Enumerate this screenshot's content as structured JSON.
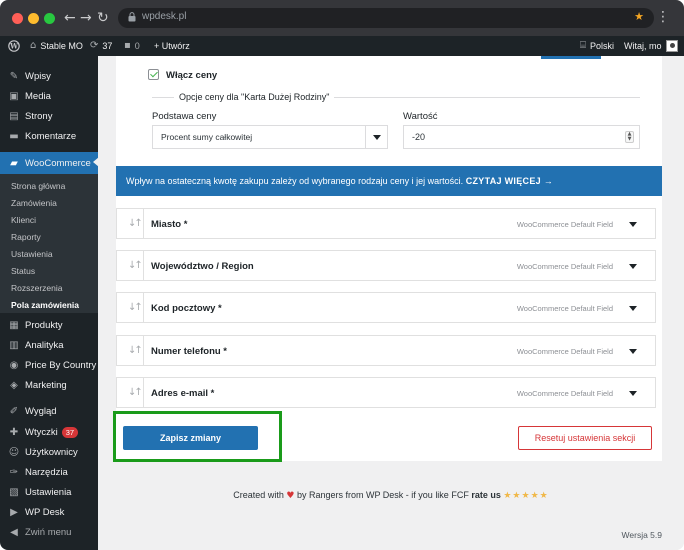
{
  "browser": {
    "url": "wpdesk.pl",
    "colors": {
      "close": "#ff5f57",
      "minimize": "#febc2e",
      "maximize": "#28c840"
    }
  },
  "adminbar": {
    "site_name": "Stable MO",
    "updates_count": "37",
    "comments_count": "0",
    "new_label": "+ Utwórz",
    "language": "Polski",
    "greeting": "Witaj, mo"
  },
  "sidebar": {
    "items": [
      {
        "icon": "pin-icon",
        "label": "Wpisy"
      },
      {
        "icon": "media-icon",
        "label": "Media"
      },
      {
        "icon": "page-icon",
        "label": "Strony"
      },
      {
        "icon": "comment-icon",
        "label": "Komentarze"
      },
      {
        "icon": "woocommerce-icon",
        "label": "WooCommerce"
      }
    ],
    "submenu": [
      "Strona główna",
      "Zamówienia",
      "Klienci",
      "Raporty",
      "Ustawienia",
      "Status",
      "Rozszerzenia",
      "Pola zamówienia"
    ],
    "items_after": [
      {
        "icon": "products-icon",
        "label": "Produkty"
      },
      {
        "icon": "analytics-icon",
        "label": "Analityka"
      },
      {
        "icon": "price-icon",
        "label": "Price By Country"
      },
      {
        "icon": "marketing-icon",
        "label": "Marketing"
      },
      {
        "icon": "appearance-icon",
        "label": "Wygląd"
      },
      {
        "icon": "plugins-icon",
        "label": "Wtyczki",
        "badge": "37"
      },
      {
        "icon": "users-icon",
        "label": "Użytkownicy"
      },
      {
        "icon": "tools-icon",
        "label": "Narzędzia"
      },
      {
        "icon": "settings-icon",
        "label": "Ustawienia"
      },
      {
        "icon": "wpdesk-icon",
        "label": "WP Desk"
      },
      {
        "icon": "collapse-icon",
        "label": "Zwiń menu"
      }
    ]
  },
  "price_section": {
    "enable_label": "Włącz ceny",
    "legend": "Opcje ceny dla \"Karta Dużej Rodziny\"",
    "base_label": "Podstawa ceny",
    "base_value": "Procent sumy całkowitej",
    "value_label": "Wartość",
    "value": "-20"
  },
  "notice": {
    "text": "Wpływ na ostateczną kwotę zakupu zależy od wybranego rodzaju ceny i jej wartości.",
    "link": "CZYTAJ WIĘCEJ →"
  },
  "fields": [
    {
      "name": "Miasto *",
      "tag": "WooCommerce Default Field"
    },
    {
      "name": "Województwo / Region",
      "tag": "WooCommerce Default Field"
    },
    {
      "name": "Kod pocztowy *",
      "tag": "WooCommerce Default Field"
    },
    {
      "name": "Numer telefonu *",
      "tag": "WooCommerce Default Field"
    },
    {
      "name": "Adres e-mail *",
      "tag": "WooCommerce Default Field"
    }
  ],
  "actions": {
    "save": "Zapisz zmiany",
    "reset": "Resetuj ustawienia sekcji"
  },
  "footer": {
    "prefix": "Created with",
    "middle": "by Rangers from WP Desk - if you like FCF",
    "rate": "rate us",
    "stars": "★★★★★",
    "version": "Wersja 5.9"
  }
}
